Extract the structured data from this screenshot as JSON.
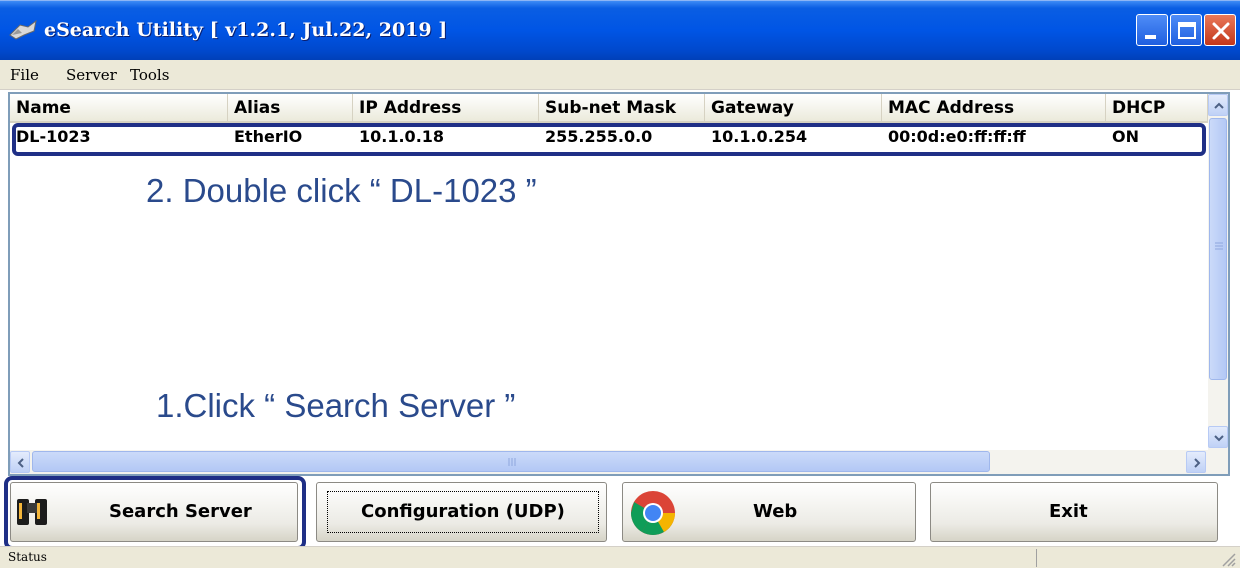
{
  "window": {
    "title": "eSearch Utility [ v1.2.1, Jul.22, 2019 ]",
    "icon": "binoculars-icon",
    "controls": [
      "minimize",
      "maximize",
      "close"
    ]
  },
  "menu": {
    "file": "File",
    "server": "Server",
    "tools": "Tools"
  },
  "table": {
    "columns": [
      "Name",
      "Alias",
      "IP Address",
      "Sub-net Mask",
      "Gateway",
      "MAC Address",
      "DHCP"
    ],
    "rows": [
      [
        "DL-1023",
        "EtherIO",
        "10.1.0.18",
        "255.255.0.0",
        "10.1.0.254",
        "00:0d:e0:ff:ff:ff",
        "ON"
      ]
    ]
  },
  "annotations": {
    "step2": "2. Double click “ DL-1023 ”",
    "step1": "1.Click “ Search Server ”",
    "highlight_color": "#1f2f86"
  },
  "buttons": {
    "search_server": "Search Server",
    "configuration": "Configuration (UDP)",
    "web": "Web",
    "exit": "Exit"
  },
  "status": {
    "label": "Status"
  },
  "colors": {
    "titlebar": "#0055e5",
    "annotation_text": "#2a4a8c",
    "face": "#ece9d8"
  }
}
